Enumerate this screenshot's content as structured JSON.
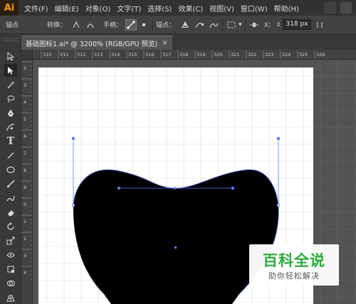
{
  "app": {
    "logo": "Ai"
  },
  "menu": [
    "文件(F)",
    "编辑(E)",
    "对象(O)",
    "文字(T)",
    "选择(S)",
    "效果(C)",
    "视图(V)",
    "窗口(W)",
    "帮助(H)"
  ],
  "control_bar": {
    "anchor_label": "锚点",
    "convert_label": "转换：",
    "handle_label": "手柄：",
    "anchors_label": "锚点：",
    "x_label": "X：",
    "x_value": "318 px"
  },
  "document_tab": {
    "title": "基础图标1.ai* @ 3200% (RGB/GPU 预览)",
    "close": "×"
  },
  "ruler": {
    "h_ticks": [
      "310",
      "311",
      "312",
      "313",
      "314",
      "315",
      "316",
      "317",
      "318",
      "319",
      "320",
      "321",
      "322",
      "323",
      "324",
      "325",
      "326"
    ],
    "v_ticks": [
      "2",
      "3",
      "4",
      "5",
      "6",
      "7",
      "8",
      "9",
      "0",
      "1",
      "2",
      "3",
      "4"
    ]
  },
  "tools": [
    "selection-tool",
    "direct-selection-tool",
    "magic-wand-tool",
    "lasso-tool",
    "pen-tool",
    "curvature-tool",
    "type-tool",
    "line-tool",
    "ellipse-tool",
    "paintbrush-tool",
    "shaper-tool",
    "eraser-tool",
    "rotate-tool",
    "scale-tool",
    "width-tool",
    "free-transform-tool",
    "shape-builder-tool",
    "perspective-grid-tool",
    "mesh-tool"
  ],
  "colors": {
    "selection": "#5a78ff",
    "shape_fill": "#000000",
    "artboard": "#ffffff",
    "pasteboard": "#535353",
    "grid_line": "#d9d9d9",
    "watermark_green": "#2eaa3c"
  },
  "watermark": {
    "brand": "百科全说",
    "slogan": "助你轻松解决"
  }
}
